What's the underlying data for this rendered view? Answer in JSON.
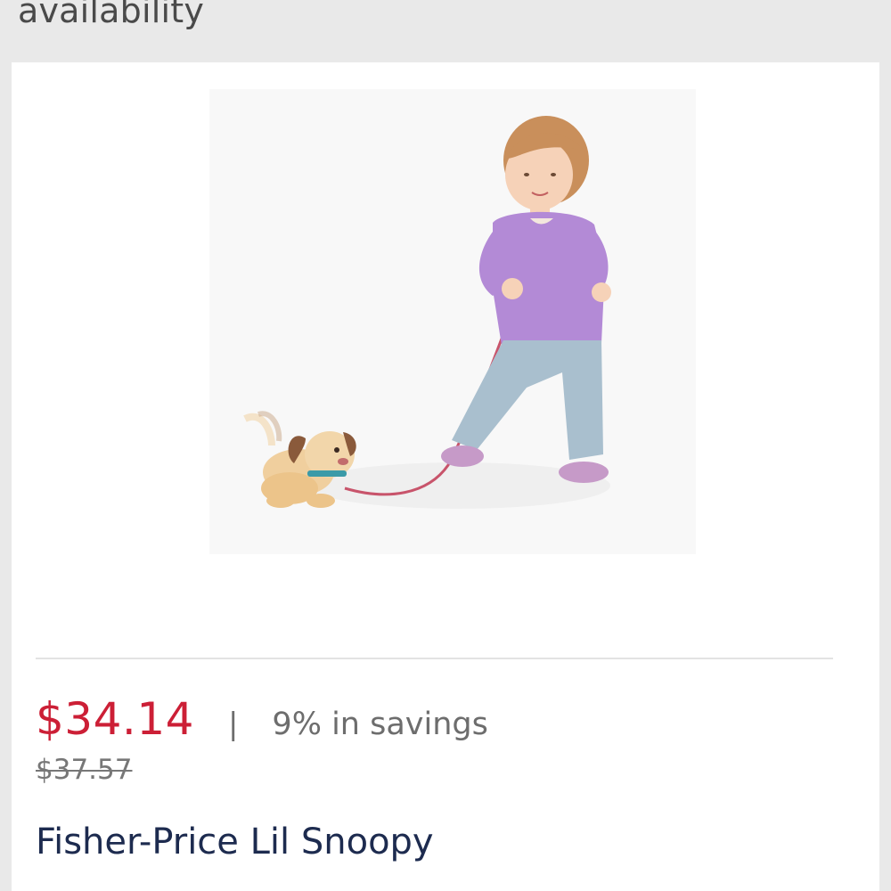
{
  "header": {
    "text": "availability"
  },
  "product": {
    "image_alt": "Toddler walking Fisher-Price Lil Snoopy pull toy on a leash",
    "price": "$34.14",
    "separator": "|",
    "savings": "9% in savings",
    "original_price": "$37.57",
    "title": "Fisher-Price Lil Snoopy"
  },
  "colors": {
    "price": "#cc1f36",
    "title": "#1d2b4f",
    "muted": "#6d6d6d",
    "background": "#e9e9e9",
    "card": "#ffffff"
  }
}
